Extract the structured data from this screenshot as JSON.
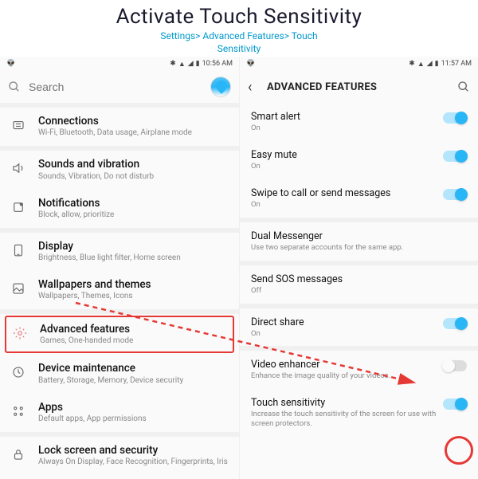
{
  "header": {
    "title": "Activate Touch Sensitivity",
    "breadcrumb_line1": "Settings> Advanced Features> Touch",
    "breadcrumb_line2": "Sensitivity"
  },
  "phone1": {
    "status_time": "10:56 AM",
    "search_placeholder": "Search",
    "items": [
      {
        "title": "Connections",
        "sub": "Wi-Fi, Bluetooth, Data usage, Airplane mode",
        "icon": "connections"
      },
      {
        "title": "Sounds and vibration",
        "sub": "Sounds, Vibration, Do not disturb",
        "icon": "sound"
      },
      {
        "title": "Notifications",
        "sub": "Block, allow, prioritize",
        "icon": "notifications"
      },
      {
        "title": "Display",
        "sub": "Brightness, Blue light filter, Home screen",
        "icon": "display"
      },
      {
        "title": "Wallpapers and themes",
        "sub": "Wallpapers, Themes, Icons",
        "icon": "wallpaper"
      },
      {
        "title": "Advanced features",
        "sub": "Games, One-handed mode",
        "icon": "advanced"
      },
      {
        "title": "Device maintenance",
        "sub": "Battery, Storage, Memory, Device security",
        "icon": "maintenance"
      },
      {
        "title": "Apps",
        "sub": "Default apps, App permissions",
        "icon": "apps"
      },
      {
        "title": "Lock screen and security",
        "sub": "Always On Display, Face Recognition, Fingerprints, Iris",
        "icon": "lock"
      }
    ]
  },
  "phone2": {
    "status_time": "11:57 AM",
    "screen_title": "ADVANCED FEATURES",
    "items": [
      {
        "title": "Smart alert",
        "sub": "On",
        "toggle": "on"
      },
      {
        "title": "Easy mute",
        "sub": "On",
        "toggle": "on"
      },
      {
        "title": "Swipe to call or send messages",
        "sub": "On",
        "toggle": "on"
      },
      {
        "title": "Dual Messenger",
        "sub": "Use two separate accounts for the same app.",
        "toggle": null
      },
      {
        "title": "Send SOS messages",
        "sub": "Off",
        "toggle": null
      },
      {
        "title": "Direct share",
        "sub": "On",
        "toggle": "on"
      },
      {
        "title": "Video enhancer",
        "sub": "Enhance the image quality of your videos.",
        "toggle": "off"
      },
      {
        "title": "Touch sensitivity",
        "sub": "Increase the touch sensitivity of the screen for use with screen protectors.",
        "toggle": "on"
      }
    ]
  }
}
